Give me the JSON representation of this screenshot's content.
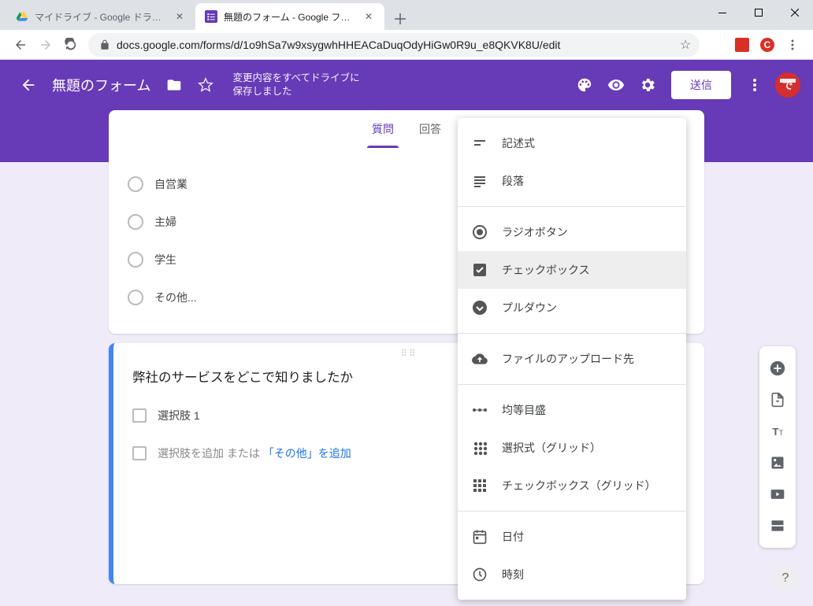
{
  "browser": {
    "tabs": [
      {
        "title": "マイドライブ - Google ドライブ",
        "favicon": "drive"
      },
      {
        "title": "無題のフォーム - Google フォーム",
        "favicon": "forms"
      }
    ],
    "url": "docs.google.com/forms/d/1o9hSa7w9xsygwhHHEACaDuqOdyHiGw0R9u_e8QKVK8U/edit"
  },
  "header": {
    "form_title": "無題のフォーム",
    "save_status_line1": "変更内容をすべてドライブに",
    "save_status_line2": "保存しました",
    "send_label": "送信"
  },
  "form_tabs": {
    "questions": "質問",
    "responses": "回答"
  },
  "question_card1": {
    "options": [
      {
        "label": "自営業"
      },
      {
        "label": "主婦"
      },
      {
        "label": "学生"
      },
      {
        "label": "その他..."
      }
    ]
  },
  "question_card2": {
    "title": "弊社のサービスをどこで知りましたか",
    "option1_label": "選択肢 1",
    "add_option_text": "選択肢を追加",
    "or_text": "または",
    "add_other_text": "「その他」を追加"
  },
  "type_menu": {
    "items": [
      {
        "id": "short_answer",
        "label": "記述式",
        "icon": "short-text"
      },
      {
        "id": "paragraph",
        "label": "段落",
        "icon": "paragraph"
      },
      {
        "id": "radio",
        "label": "ラジオボタン",
        "icon": "radio"
      },
      {
        "id": "checkbox",
        "label": "チェックボックス",
        "icon": "checkbox"
      },
      {
        "id": "dropdown",
        "label": "プルダウン",
        "icon": "dropdown"
      },
      {
        "id": "file_upload",
        "label": "ファイルのアップロード先",
        "icon": "upload"
      },
      {
        "id": "linear_scale",
        "label": "均等目盛",
        "icon": "scale"
      },
      {
        "id": "mc_grid",
        "label": "選択式（グリッド）",
        "icon": "grid-radio"
      },
      {
        "id": "cb_grid",
        "label": "チェックボックス（グリッド）",
        "icon": "grid-check"
      },
      {
        "id": "date",
        "label": "日付",
        "icon": "date"
      },
      {
        "id": "time",
        "label": "時刻",
        "icon": "time"
      }
    ]
  }
}
